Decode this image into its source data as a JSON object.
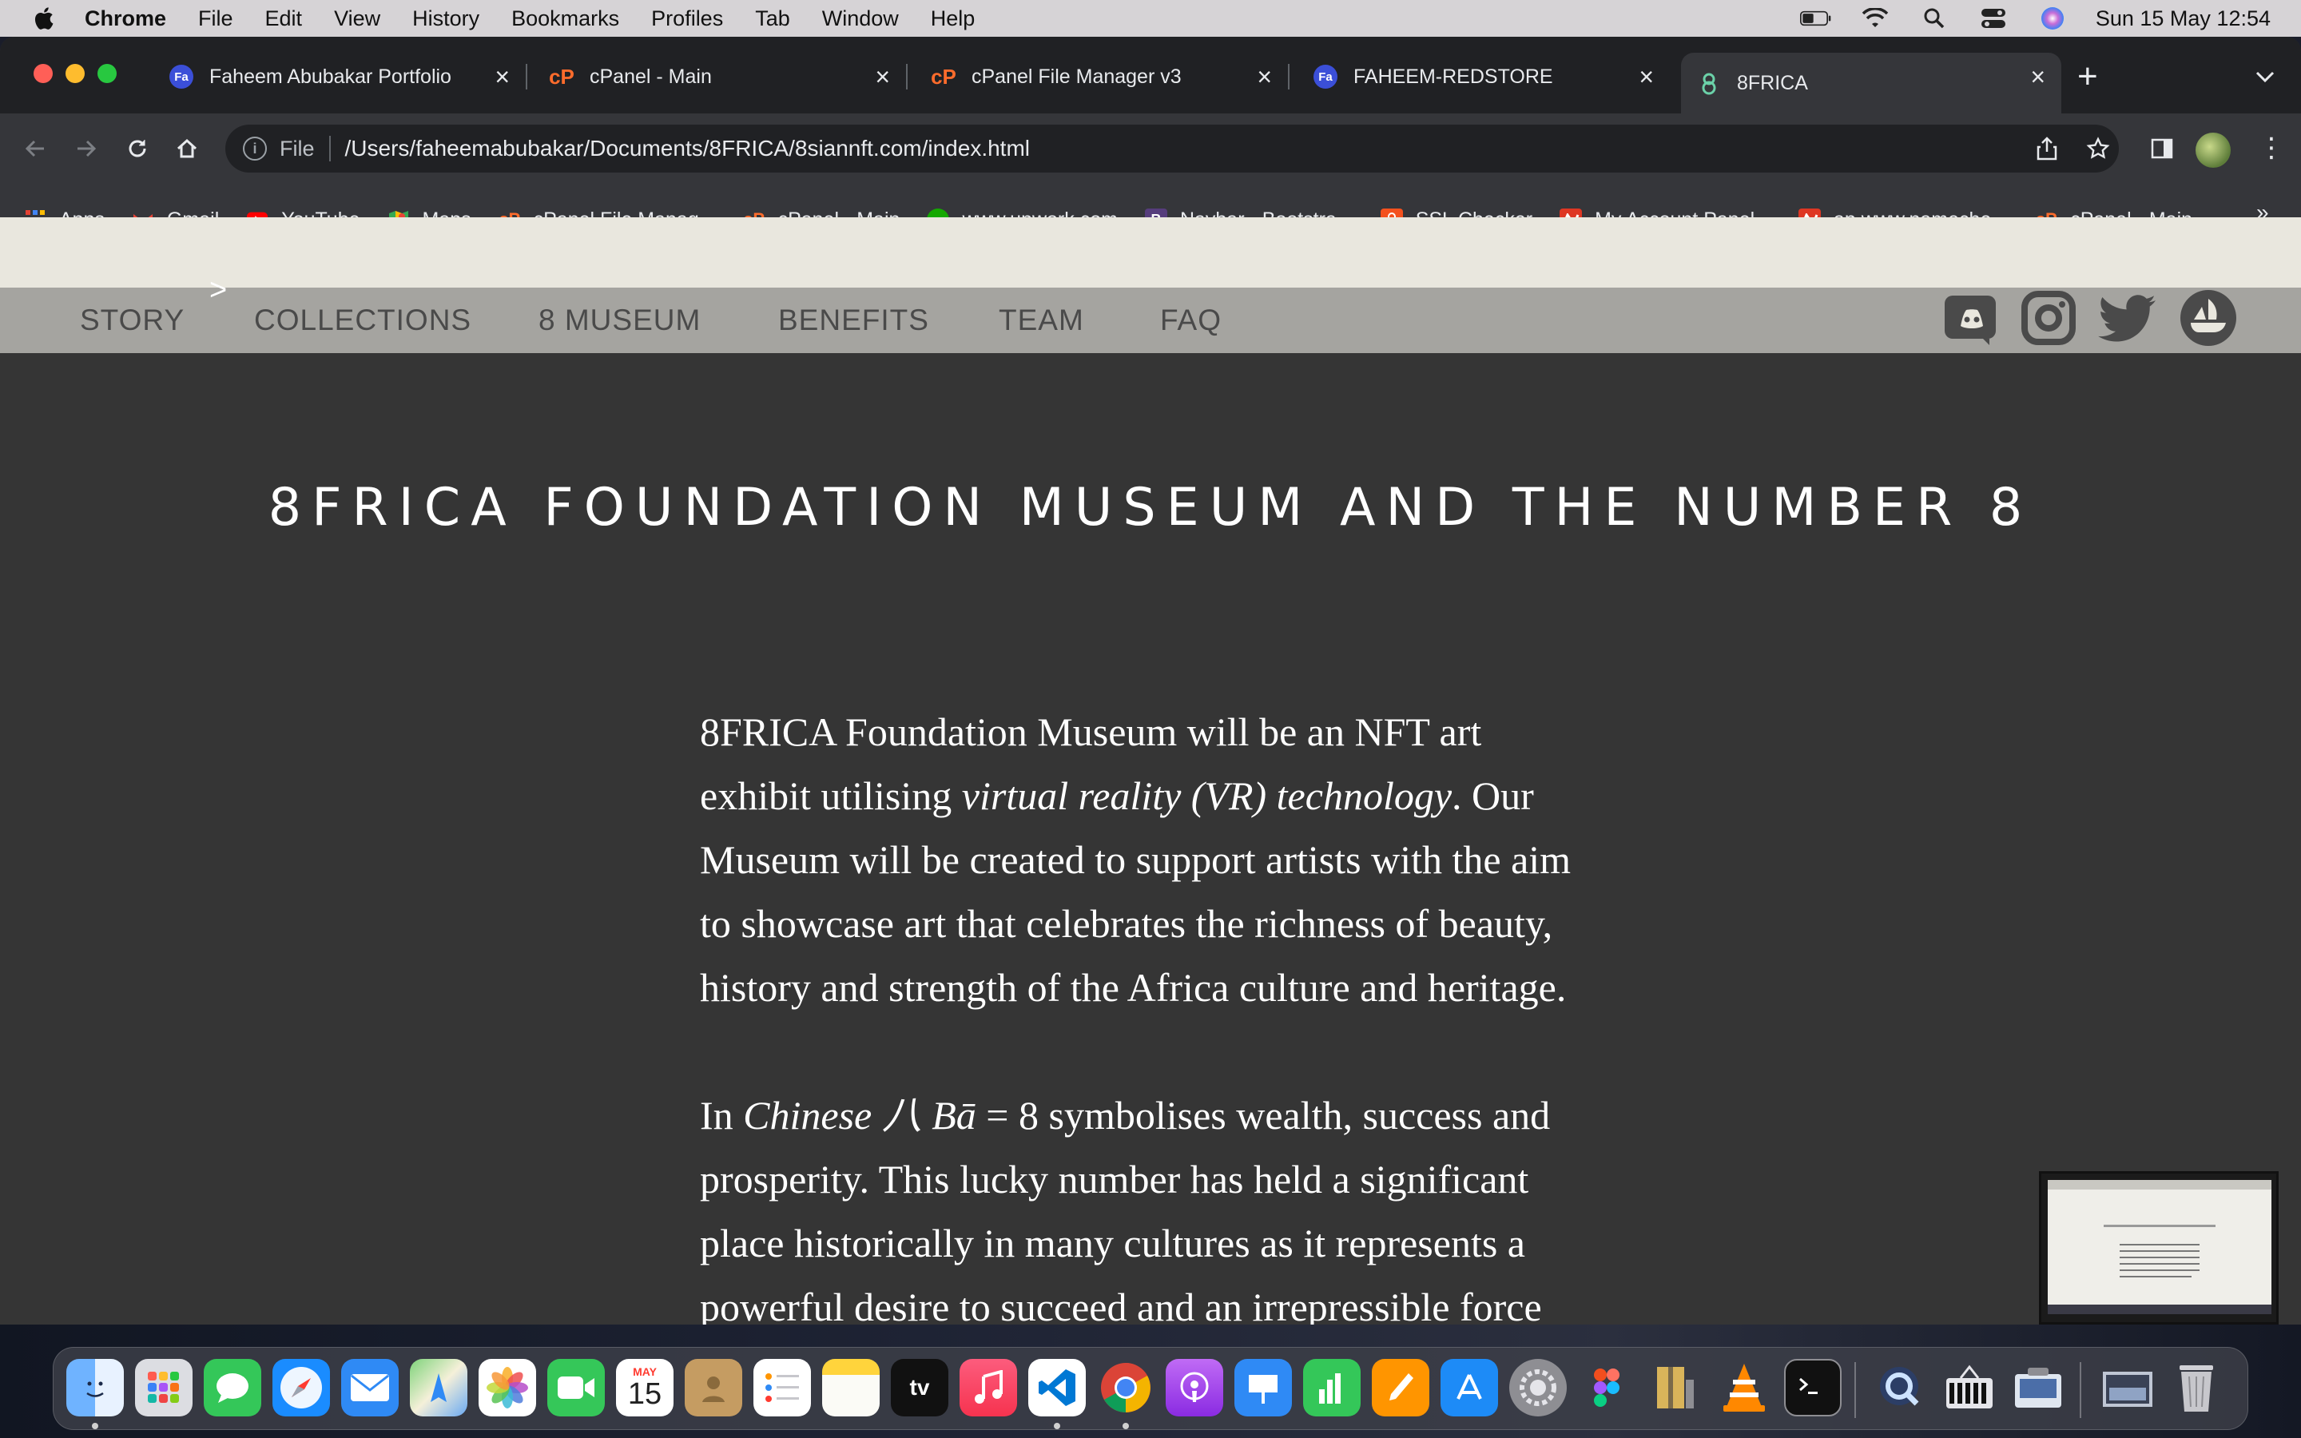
{
  "menubar": {
    "app_name": "Chrome",
    "items": [
      "File",
      "Edit",
      "View",
      "History",
      "Bookmarks",
      "Profiles",
      "Tab",
      "Window",
      "Help"
    ],
    "datetime": "Sun 15 May  12:54"
  },
  "tabs": [
    {
      "title": "Faheem Abubakar Portfolio",
      "icon": "fa-logo-icon",
      "active": false
    },
    {
      "title": "cPanel - Main",
      "icon": "cpanel-icon",
      "active": false
    },
    {
      "title": "cPanel File Manager v3",
      "icon": "cpanel-icon",
      "active": false
    },
    {
      "title": "FAHEEM-REDSTORE",
      "icon": "fa-logo-icon",
      "active": false
    },
    {
      "title": "8FRICA",
      "icon": "8frica-icon",
      "active": true
    }
  ],
  "address_bar": {
    "scheme_label": "File",
    "url": "/Users/faheemabubakar/Documents/8FRICA/8siannft.com/index.html"
  },
  "bookmarks": [
    {
      "label": "Apps",
      "icon": "apps-grid-icon"
    },
    {
      "label": "Gmail",
      "icon": "gmail-icon"
    },
    {
      "label": "YouTube",
      "icon": "youtube-icon"
    },
    {
      "label": "Maps",
      "icon": "maps-icon"
    },
    {
      "label": "cPanel File Manag...",
      "icon": "cpanel-icon"
    },
    {
      "label": "cPanel - Main",
      "icon": "cpanel-icon"
    },
    {
      "label": "www.upwork.com",
      "icon": "upwork-icon"
    },
    {
      "label": "Navbar · Bootstra...",
      "icon": "bootstrap-icon"
    },
    {
      "label": "SSL Checker",
      "icon": "ssl-lock-icon"
    },
    {
      "label": "My Account Panel...",
      "icon": "namecheap-icon"
    },
    {
      "label": "ap.www.nameche...",
      "icon": "namecheap-icon"
    },
    {
      "label": "cPanel - Main",
      "icon": "cpanel-icon"
    }
  ],
  "site": {
    "nav": [
      "STORY",
      "COLLECTIONS",
      "8 MUSEUM",
      "BENEFITS",
      "TEAM",
      "FAQ"
    ],
    "nav_caret": ">",
    "social": [
      "discord-icon",
      "instagram-icon",
      "twitter-icon",
      "opensea-icon"
    ],
    "title": "8FRICA FOUNDATION MUSEUM AND THE NUMBER 8",
    "para1": {
      "pre": "8FRICA Foundation Museum will be an NFT art exhibit utilising ",
      "em": "virtual reality (VR) technology",
      "post": ". Our Museum will be created to support artists with the aim to showcase art that celebrates the richness of beauty, history and strength of the Africa culture and heritage."
    },
    "para2": {
      "pre": "In ",
      "em": "Chinese 八 Bā",
      "post": " = 8 symbolises wealth, success and prosperity. This lucky number has held a significant place historically in many cultures as it represents a powerful desire to succeed and an irrepressible force"
    }
  },
  "dock": {
    "calendar_month": "MAY",
    "calendar_day": "15",
    "tv_label": "tv",
    "apps": [
      "finder-icon",
      "launchpad-icon",
      "messages-icon",
      "safari-icon",
      "mail-icon",
      "maps-icon",
      "photos-icon",
      "facetime-icon",
      "calendar-icon",
      "contacts-icon",
      "reminders-icon",
      "notes-icon",
      "appletv-icon",
      "music-icon",
      "vscode-icon",
      "chrome-icon",
      "podcasts-icon",
      "keynote-icon",
      "numbers-icon",
      "pages-icon",
      "appstore-icon",
      "system-preferences-icon",
      "figma-icon",
      "archive-utility-icon",
      "vlc-icon",
      "terminal-icon",
      "quicktime-icon",
      "preview-icon",
      "screenshot-icon",
      "downloads-stack-icon",
      "trash-icon"
    ]
  },
  "colors": {
    "page_bg": "#353535",
    "nav_top": "#e9e7de",
    "nav_bottom": "#a5a4a0",
    "chrome_dark": "#202124",
    "chrome_toolbar": "#35363a"
  }
}
